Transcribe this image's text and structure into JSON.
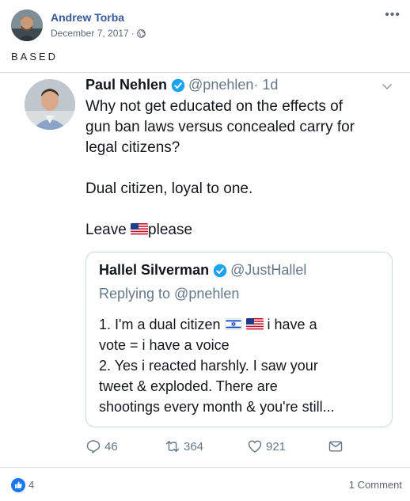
{
  "post": {
    "author": "Andrew Torba",
    "date": "December 7, 2017",
    "separator": "·",
    "text": "BASED",
    "more_label": "•••"
  },
  "tweet": {
    "author_name": "Paul Nehlen",
    "handle": "@pnehlen",
    "time": "· 1d",
    "body": {
      "line1": "Why not get educated on the effects of",
      "line2": "gun ban laws versus concealed carry for",
      "line3": "legal citizens?",
      "line4": "Dual citizen, loyal to one.",
      "leave_word": "Leave ",
      "please_word": "please"
    },
    "quote": {
      "author_name": "Hallel Silverman",
      "handle": "@JustHallel",
      "replying": "Replying to @pnehlen",
      "line1_a": "1. I'm a dual citizen ",
      "line1_b": " i have a",
      "line2": "vote = i have a voice",
      "line3": "2. Yes i reacted harshly. I saw your",
      "line4": "tweet & exploded. There are",
      "line5": "shootings every month & you're still..."
    },
    "actions": {
      "replies": "46",
      "retweets": "364",
      "likes": "921"
    }
  },
  "footer": {
    "like_count": "4",
    "comments": "1 Comment"
  },
  "colors": {
    "fb_blue": "#385898",
    "twitter_blue": "#1da1f2",
    "twitter_grey": "#657786",
    "like_blue": "#1877f2"
  },
  "icons": {
    "globe": "globe-icon",
    "verified": "verified-badge-icon",
    "caret": "chevron-down-icon",
    "reply": "reply-icon",
    "retweet": "retweet-icon",
    "like": "heart-icon",
    "dm": "envelope-icon",
    "thumbs": "thumbs-up-icon"
  }
}
